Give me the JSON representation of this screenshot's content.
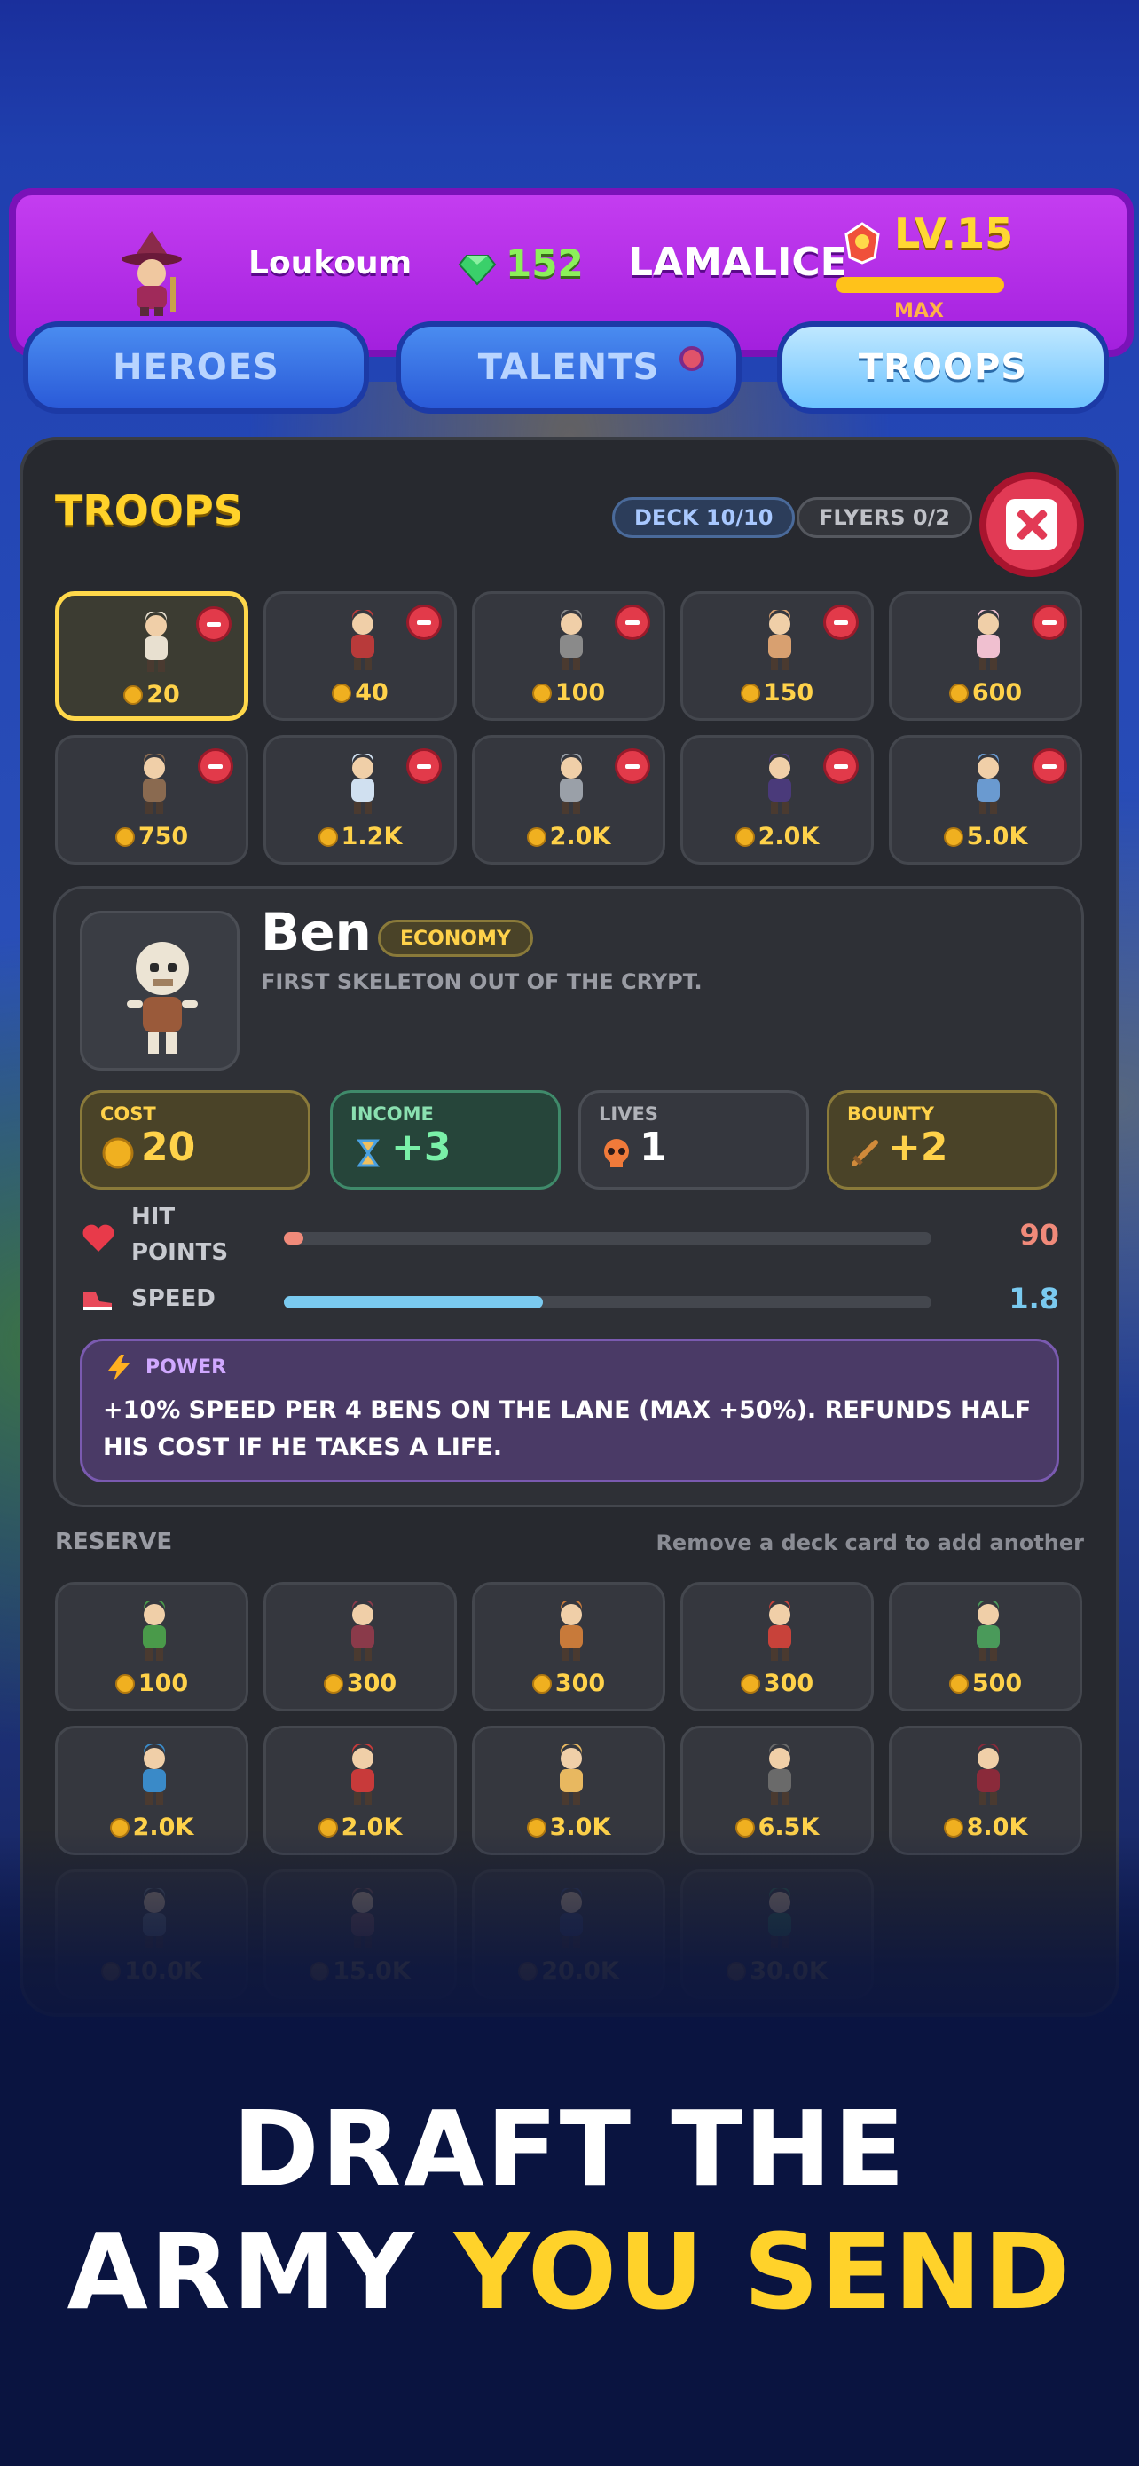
{
  "topbar": {
    "player_name": "Loukoum",
    "gems": "152",
    "opponent_name": "LAMALICE",
    "level": "LV.15",
    "level_max": "MAX",
    "level_progress": 1.0
  },
  "tabs": [
    {
      "label": "HEROES",
      "active": false
    },
    {
      "label": "TALENTS",
      "active": false,
      "notification": true
    },
    {
      "label": "TROOPS",
      "active": true
    }
  ],
  "panel": {
    "title": "TROOPS",
    "deck_pill": "DECK 10/10",
    "flyers_pill": "FLYERS 0/2"
  },
  "deck": [
    {
      "cost": "20",
      "color": "#e8e0d0",
      "selected": true
    },
    {
      "cost": "40",
      "color": "#b83a3a"
    },
    {
      "cost": "100",
      "color": "#8a8a8a"
    },
    {
      "cost": "150",
      "color": "#d8a070"
    },
    {
      "cost": "600",
      "color": "#f0c0d0"
    },
    {
      "cost": "750",
      "color": "#8a6a50"
    },
    {
      "cost": "1.2K",
      "color": "#d0e0f0"
    },
    {
      "cost": "2.0K",
      "color": "#9aa0a8"
    },
    {
      "cost": "2.0K",
      "color": "#4a3a7a"
    },
    {
      "cost": "5.0K",
      "color": "#6a9ad0"
    }
  ],
  "detail": {
    "name": "Ben",
    "tag": "ECONOMY",
    "description": "FIRST SKELETON OUT OF THE CRYPT.",
    "stats": {
      "cost_label": "COST",
      "cost_value": "20",
      "income_label": "INCOME",
      "income_value": "+3",
      "lives_label": "LIVES",
      "lives_value": "1",
      "bounty_label": "BOUNTY",
      "bounty_value": "+2"
    },
    "hit_points_label_1": "HIT",
    "hit_points_label_2": "POINTS",
    "hit_points_value": "90",
    "hit_points_fraction": 0.03,
    "speed_label": "SPEED",
    "speed_value": "1.8",
    "speed_fraction": 0.4,
    "power_title": "POWER",
    "power_text": "+10% SPEED PER 4 BENS ON THE LANE (MAX +50%). REFUNDS HALF HIS COST IF HE TAKES A LIFE."
  },
  "reserve": {
    "title": "RESERVE",
    "hint": "Remove a deck card to add another",
    "cards": [
      {
        "cost": "100",
        "color": "#4a9a4a"
      },
      {
        "cost": "300",
        "color": "#8a3a4a"
      },
      {
        "cost": "300",
        "color": "#c87a3a"
      },
      {
        "cost": "300",
        "color": "#c8423a"
      },
      {
        "cost": "500",
        "color": "#4a9a5a"
      },
      {
        "cost": "2.0K",
        "color": "#3a8ac8"
      },
      {
        "cost": "2.0K",
        "color": "#c83a3a"
      },
      {
        "cost": "3.0K",
        "color": "#e8b860"
      },
      {
        "cost": "6.5K",
        "color": "#6a6a6a"
      },
      {
        "cost": "8.0K",
        "color": "#8a2a3a"
      },
      {
        "cost": "10.0K",
        "color": "#6a7a8a"
      },
      {
        "cost": "15.0K",
        "color": "#8a5a5a"
      },
      {
        "cost": "20.0K",
        "color": "#3a4a7a"
      },
      {
        "cost": "30.0K",
        "color": "#2a7a5a"
      }
    ]
  },
  "headline": {
    "line1": "DRAFT THE",
    "line2_a": "ARMY ",
    "line2_b": "YOU SEND"
  },
  "colors": {
    "accent_yellow": "#ffd22a",
    "hp_bar": "#f08a7a",
    "speed_bar": "#7acaf0"
  }
}
